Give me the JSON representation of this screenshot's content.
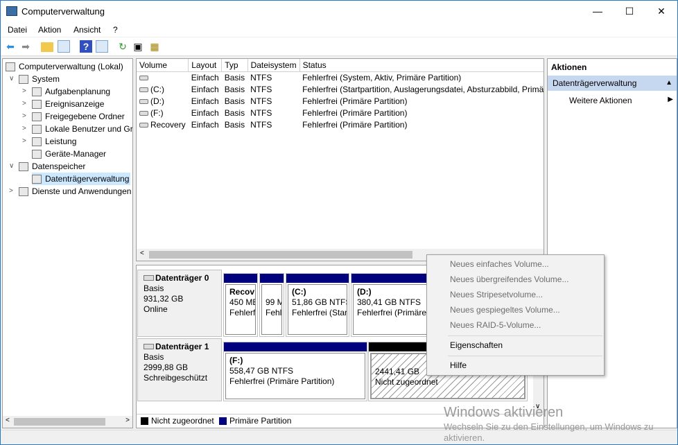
{
  "window": {
    "title": "Computerverwaltung",
    "minimize": "—",
    "maximize": "☐",
    "close": "✕"
  },
  "menu": [
    "Datei",
    "Aktion",
    "Ansicht",
    "?"
  ],
  "toolbar": [
    "back-icon",
    "forward-icon",
    "up-folder-icon",
    "show-hide-tree-icon",
    "help-icon",
    "show-hide-action-pane-icon",
    "refresh-icon",
    "properties-icon",
    "settings-icon"
  ],
  "tree": [
    {
      "label": "Computerverwaltung (Lokal)",
      "level": 0,
      "toggle": ""
    },
    {
      "label": "System",
      "level": 1,
      "toggle": "∨"
    },
    {
      "label": "Aufgabenplanung",
      "level": 2,
      "toggle": ">"
    },
    {
      "label": "Ereignisanzeige",
      "level": 2,
      "toggle": ">"
    },
    {
      "label": "Freigegebene Ordner",
      "level": 2,
      "toggle": ">"
    },
    {
      "label": "Lokale Benutzer und Gruppen",
      "level": 2,
      "toggle": ">"
    },
    {
      "label": "Leistung",
      "level": 2,
      "toggle": ">"
    },
    {
      "label": "Geräte-Manager",
      "level": 2,
      "toggle": ""
    },
    {
      "label": "Datenspeicher",
      "level": 1,
      "toggle": "∨"
    },
    {
      "label": "Datenträgerverwaltung",
      "level": 2,
      "toggle": "",
      "selected": true
    },
    {
      "label": "Dienste und Anwendungen",
      "level": 1,
      "toggle": ">"
    }
  ],
  "volumes": {
    "columns": [
      "Volume",
      "Layout",
      "Typ",
      "Dateisystem",
      "Status"
    ],
    "rows": [
      [
        "",
        "Einfach",
        "Basis",
        "NTFS",
        "Fehlerfrei (System, Aktiv, Primäre Partition)"
      ],
      [
        "(C:)",
        "Einfach",
        "Basis",
        "NTFS",
        "Fehlerfrei (Startpartition, Auslagerungsdatei, Absturzabbild, Primäre Partition)"
      ],
      [
        "(D:)",
        "Einfach",
        "Basis",
        "NTFS",
        "Fehlerfrei (Primäre Partition)"
      ],
      [
        "(F:)",
        "Einfach",
        "Basis",
        "NTFS",
        "Fehlerfrei (Primäre Partition)"
      ],
      [
        "Recovery",
        "Einfach",
        "Basis",
        "NTFS",
        "Fehlerfrei (Primäre Partition)"
      ]
    ]
  },
  "disks": [
    {
      "name": "Datenträger 0",
      "type": "Basis",
      "size": "931,32 GB",
      "state": "Online",
      "partitions": [
        {
          "name": "Recov",
          "size": "450 ME",
          "status": "Fehlerf"
        },
        {
          "name": "",
          "size": "99 M",
          "status": "Fehl"
        },
        {
          "name": "(C:)",
          "size": "51,86 GB NTFS",
          "status": "Fehlerfrei (Star"
        },
        {
          "name": "(D:)",
          "size": "380,41 GB NTFS",
          "status": "Fehlerfrei (Primäre"
        }
      ]
    },
    {
      "name": "Datenträger 1",
      "type": "Basis",
      "size": "2999,88 GB",
      "state": "Schreibgeschützt",
      "partitions": [
        {
          "name": "(F:)",
          "size": "558,47 GB NTFS",
          "status": "Fehlerfrei (Primäre Partition)"
        },
        {
          "name": "",
          "size": "2441,41 GB",
          "status": "Nicht zugeordnet"
        }
      ]
    }
  ],
  "legend": [
    {
      "label": "Nicht zugeordnet",
      "color": "#000000"
    },
    {
      "label": "Primäre Partition",
      "color": "#00007f"
    }
  ],
  "actions": {
    "header": "Aktionen",
    "section": "Datenträgerverwaltung",
    "more": "Weitere Aktionen"
  },
  "context_menu": {
    "items": [
      {
        "label": "Neues einfaches Volume...",
        "enabled": false
      },
      {
        "label": "Neues übergreifendes Volume...",
        "enabled": false
      },
      {
        "label": "Neues Stripesetvolume...",
        "enabled": false
      },
      {
        "label": "Neues gespiegeltes Volume...",
        "enabled": false
      },
      {
        "label": "Neues RAID-5-Volume...",
        "enabled": false
      },
      {
        "label": "Eigenschaften",
        "enabled": true
      },
      {
        "label": "Hilfe",
        "enabled": true
      }
    ]
  },
  "watermark": {
    "title": "Windows aktivieren",
    "line1": "Wechseln Sie zu den Einstellungen, um Windows zu",
    "line2": "aktivieren."
  }
}
